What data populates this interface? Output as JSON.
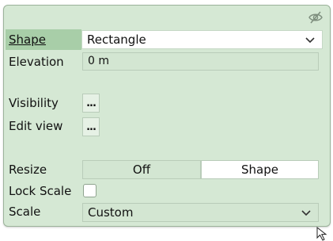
{
  "panel": {
    "visibility_toggle_icon": "eye-off-icon",
    "rows": {
      "shape": {
        "label": "Shape",
        "value": "Rectangle"
      },
      "elevation": {
        "label": "Elevation",
        "value": "0 m"
      },
      "visibility": {
        "label": "Visibility",
        "button": "..."
      },
      "edit_view": {
        "label": "Edit view",
        "button": "..."
      },
      "resize": {
        "label": "Resize",
        "options": [
          "Off",
          "Shape"
        ],
        "selected": "Shape"
      },
      "lock_scale": {
        "label": "Lock Scale",
        "checked": false
      },
      "scale": {
        "label": "Scale",
        "value": "Custom"
      }
    }
  },
  "colors": {
    "panel_bg": "#d5e8d4",
    "active_label_bg": "#a8cea8"
  }
}
